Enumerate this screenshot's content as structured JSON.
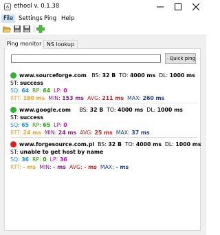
{
  "window": {
    "title": "ethool v. 0.1.38",
    "controls": [
      "minimize",
      "maximize",
      "close"
    ]
  },
  "menu": {
    "items": [
      "File",
      "Settings",
      "Ping",
      "Help"
    ],
    "active_index": 0
  },
  "toolbar": {
    "icons": [
      "open-folder-icon",
      "save-icon",
      "save-all-icon",
      "add-icon"
    ]
  },
  "tabs": [
    {
      "label": "Ping monitor",
      "active": true
    },
    {
      "label": "NS lookup",
      "active": false
    }
  ],
  "ping": {
    "host_value": "",
    "quick_ping_label": "Quick ping"
  },
  "results": [
    {
      "status": "ok",
      "status_color": "#2fb52f",
      "host": "www.sourceforge.com",
      "bs_label": "BS:",
      "bs": "32 B",
      "to_label": "TO:",
      "to": "4000 ms",
      "dl_label": "DL:",
      "dl": "1000 ms",
      "st_label": "ST:",
      "st": "success",
      "sq_label": "SQ:",
      "sq": "64",
      "rp_label": "RP:",
      "rp": "64",
      "lp_label": "LP:",
      "lp": "0",
      "rtt_label": "RTT:",
      "rtt": "180 ms",
      "min_label": "MIN:",
      "min": "153 ms",
      "avg_label": "AVG:",
      "avg": "211 ms",
      "max_label": "MAX:",
      "max": "260 ms"
    },
    {
      "status": "ok",
      "status_color": "#2fb52f",
      "host": "www.google.com",
      "bs_label": "BS:",
      "bs": "32 B",
      "to_label": "TO:",
      "to": "4000 ms",
      "dl_label": "DL:",
      "dl": "1000 ms",
      "st_label": "ST:",
      "st": "success",
      "sq_label": "SQ:",
      "sq": "65",
      "rp_label": "RP:",
      "rp": "65",
      "lp_label": "LP:",
      "lp": "0",
      "rtt_label": "RTT:",
      "rtt": "24 ms",
      "min_label": "MIN:",
      "min": "24 ms",
      "avg_label": "AVG:",
      "avg": "25 ms",
      "max_label": "MAX:",
      "max": "37 ms"
    },
    {
      "status": "error",
      "status_color": "#e02020",
      "host": "www.forgesource.com.pl",
      "bs_label": "BS:",
      "bs": "32 B",
      "to_label": "TO:",
      "to": "4000 ms",
      "dl_label": "DL:",
      "dl": "1000 ms",
      "st_label": "ST:",
      "st": "unable to get host by name",
      "sq_label": "SQ:",
      "sq": "36",
      "rp_label": "RP:",
      "rp": "0",
      "lp_label": "LP:",
      "lp": "36",
      "rtt_label": "RTT:",
      "rtt": "- ms",
      "min_label": "MIN:",
      "min": "- ms",
      "avg_label": "AVG:",
      "avg": "- ms",
      "max_label": "MAX:",
      "max": "- ms"
    }
  ]
}
